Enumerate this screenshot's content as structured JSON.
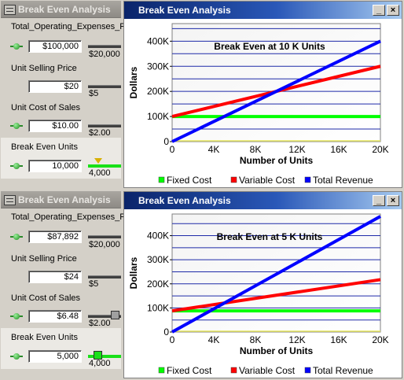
{
  "panes": [
    {
      "panel_title": "Break Even Analysis",
      "groups": [
        {
          "label": "Total_Operating_Expenses_F",
          "value": "$100,000",
          "min": "$20,000"
        },
        {
          "label": "Unit Selling Price",
          "value": "$20",
          "min": "$5"
        },
        {
          "label": "Unit Cost of Sales",
          "value": "$10.00",
          "min": "$2.00"
        },
        {
          "label": "Break Even Units",
          "value": "10,000",
          "min": "4,000"
        }
      ],
      "window_title": "Break Even Analysis",
      "chart_data": {
        "type": "line",
        "title": "Break Even  at 10 K Units",
        "xlabel": "Number of Units",
        "ylabel": "Dollars",
        "x_ticks": [
          "0",
          "4K",
          "8K",
          "12K",
          "16K",
          "20K"
        ],
        "y_ticks": [
          "0",
          "100K",
          "200K",
          "300K",
          "400K"
        ],
        "xlim": [
          0,
          20000
        ],
        "ylim": [
          0,
          470000
        ],
        "grid": true,
        "legend_position": "bottom",
        "series": [
          {
            "name": "Fixed Cost",
            "color": "#00ff00",
            "x": [
              0,
              20000
            ],
            "y": [
              100000,
              100000
            ]
          },
          {
            "name": "Variable Cost",
            "color": "#ff0000",
            "x": [
              0,
              20000
            ],
            "y": [
              100000,
              300000
            ]
          },
          {
            "name": "Total Revenue",
            "color": "#0000ff",
            "x": [
              0,
              20000
            ],
            "y": [
              0,
              400000
            ]
          }
        ]
      }
    },
    {
      "panel_title": "Break Even Analysis",
      "groups": [
        {
          "label": "Total_Operating_Expenses_F",
          "value": "$87,892",
          "min": "$20,000"
        },
        {
          "label": "Unit Selling Price",
          "value": "$24",
          "min": "$5"
        },
        {
          "label": "Unit Cost of Sales",
          "value": "$6.48",
          "min": "$2.00"
        },
        {
          "label": "Break Even Units",
          "value": "5,000",
          "min": "4,000"
        }
      ],
      "window_title": "Break Even Analysis",
      "chart_data": {
        "type": "line",
        "title": "Break Even  at 5 K Units",
        "xlabel": "Number of Units",
        "ylabel": "Dollars",
        "x_ticks": [
          "0",
          "4K",
          "8K",
          "12K",
          "16K",
          "20K"
        ],
        "y_ticks": [
          "0",
          "100K",
          "200K",
          "300K",
          "400K"
        ],
        "xlim": [
          0,
          20000
        ],
        "ylim": [
          0,
          490000
        ],
        "grid": true,
        "legend_position": "bottom",
        "series": [
          {
            "name": "Fixed Cost",
            "color": "#00ff00",
            "x": [
              0,
              20000
            ],
            "y": [
              87892,
              87892
            ]
          },
          {
            "name": "Variable Cost",
            "color": "#ff0000",
            "x": [
              0,
              20000
            ],
            "y": [
              87892,
              217492
            ]
          },
          {
            "name": "Total Revenue",
            "color": "#0000ff",
            "x": [
              0,
              20000
            ],
            "y": [
              0,
              480000
            ]
          }
        ]
      }
    }
  ],
  "icons": {
    "menu": "menu-icon",
    "minimize": "minimize-icon",
    "close": "close-icon",
    "connector": "connector-dot-icon"
  },
  "window_buttons": {
    "minimize": "_",
    "close": "×"
  }
}
